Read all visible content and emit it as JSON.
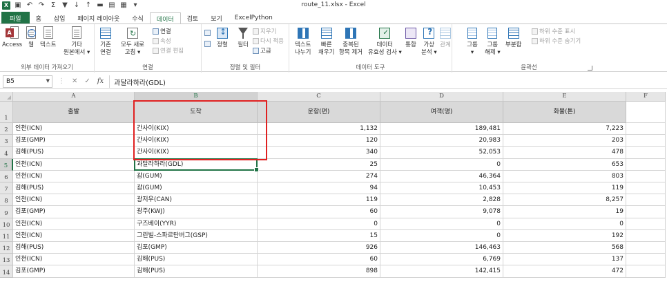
{
  "window": {
    "title": "route_11.xlsx - Excel"
  },
  "quick_access": [
    "excel-logo-icon",
    "save-icon",
    "undo-icon",
    "redo-icon",
    "autosum-icon",
    "filter-icon",
    "sort-asc-icon",
    "sort-desc-icon",
    "open-folder-icon",
    "form-icon",
    "pivot-icon",
    "customize-qat-icon"
  ],
  "tabs": [
    {
      "label": "파일",
      "active": false
    },
    {
      "label": "홈",
      "active": false
    },
    {
      "label": "삽입",
      "active": false
    },
    {
      "label": "페이지 레이아웃",
      "active": false
    },
    {
      "label": "수식",
      "active": false
    },
    {
      "label": "데이터",
      "active": true
    },
    {
      "label": "검토",
      "active": false
    },
    {
      "label": "보기",
      "active": false
    },
    {
      "label": "ExcelPython",
      "active": false
    }
  ],
  "ribbon": {
    "get_external": {
      "label": "외부 데이터 가져오기",
      "access": "Access",
      "web": "웹",
      "text": "텍스트",
      "other_1": "기타",
      "other_2": "원본에서 ▾"
    },
    "connections": {
      "label": "연결",
      "existing_1": "기존",
      "existing_2": "연결",
      "refresh_1": "모두 새로",
      "refresh_2": "고침 ▾",
      "connections": "연결",
      "properties": "속성",
      "edit_links": "연결 편집"
    },
    "sort_filter": {
      "label": "정렬 및 필터",
      "sort": "정렬",
      "filter": "필터",
      "clear": "지우기",
      "reapply": "다시 적용",
      "advanced": "고급"
    },
    "data_tools": {
      "label": "데이터 도구",
      "text_to_cols_1": "텍스트",
      "text_to_cols_2": "나누기",
      "flash_fill_1": "빠른",
      "flash_fill_2": "채우기",
      "remove_dup_1": "중복된",
      "remove_dup_2": "항목 제거",
      "validation_1": "데이터",
      "validation_2": "유효성 검사 ▾",
      "consolidate": "통합",
      "whatif_1": "가상",
      "whatif_2": "분석 ▾",
      "relationships": "관계"
    },
    "outline": {
      "label": "윤곽선",
      "group_1": "그룹",
      "group_2": "▾",
      "ungroup_1": "그룹",
      "ungroup_2": "해제 ▾",
      "subtotal": "부분합",
      "show_detail": "하위 수준 표시",
      "hide_detail": "하위 수준 숨기기"
    }
  },
  "formula_bar": {
    "name_box": "B5",
    "formula": "과달라하라(GDL)"
  },
  "sheet": {
    "columns": [
      "A",
      "B",
      "C",
      "D",
      "E",
      "F"
    ],
    "selected_column": "B",
    "selected_row": "5",
    "header_row": {
      "row": "1",
      "cells": [
        "출발",
        "도착",
        "운항(편)",
        "여객(명)",
        "화물(톤)"
      ]
    },
    "rows": [
      {
        "row": "2",
        "cells": [
          "인천(ICN)",
          "간사이(KIX)",
          "1,132",
          "189,481",
          "7,223"
        ]
      },
      {
        "row": "3",
        "cells": [
          "김포(GMP)",
          "간사이(KIX)",
          "120",
          "20,983",
          "203"
        ]
      },
      {
        "row": "4",
        "cells": [
          "김해(PUS)",
          "간사이(KIX)",
          "340",
          "52,053",
          "478"
        ]
      },
      {
        "row": "5",
        "cells": [
          "인천(ICN)",
          "과달라하라(GDL)",
          "25",
          "0",
          "653"
        ]
      },
      {
        "row": "6",
        "cells": [
          "인천(ICN)",
          "괌(GUM)",
          "274",
          "46,364",
          "803"
        ]
      },
      {
        "row": "7",
        "cells": [
          "김해(PUS)",
          "괌(GUM)",
          "94",
          "10,453",
          "119"
        ]
      },
      {
        "row": "8",
        "cells": [
          "인천(ICN)",
          "광저우(CAN)",
          "119",
          "2,828",
          "8,257"
        ]
      },
      {
        "row": "9",
        "cells": [
          "김포(GMP)",
          "광주(KWJ)",
          "60",
          "9,078",
          "19"
        ]
      },
      {
        "row": "10",
        "cells": [
          "인천(ICN)",
          "구즈베이(YYR)",
          "0",
          "0",
          "0"
        ]
      },
      {
        "row": "11",
        "cells": [
          "인천(ICN)",
          "그린빌-스파르탄버그(GSP)",
          "15",
          "0",
          "192"
        ]
      },
      {
        "row": "12",
        "cells": [
          "김해(PUS)",
          "김포(GMP)",
          "926",
          "146,463",
          "568"
        ]
      },
      {
        "row": "13",
        "cells": [
          "인천(ICN)",
          "김해(PUS)",
          "60",
          "6,769",
          "137"
        ]
      },
      {
        "row": "14",
        "cells": [
          "김포(GMP)",
          "김해(PUS)",
          "898",
          "142,415",
          "472"
        ]
      }
    ]
  },
  "colors": {
    "excel_green": "#217346",
    "highlight_red": "#e02020",
    "header_fill": "#d9d9d9"
  }
}
